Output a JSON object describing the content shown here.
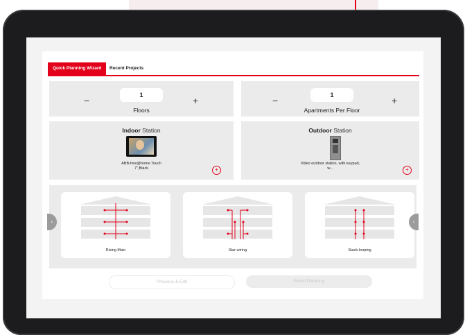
{
  "tabs": [
    {
      "label": "Quick Planning Wizard",
      "active": true
    },
    {
      "label": "Recent Projects",
      "active": false
    }
  ],
  "floors": {
    "value": "1",
    "label": "Floors",
    "minus": "−",
    "plus": "+"
  },
  "apartments": {
    "value": "1",
    "label": "Apartments Per Floor",
    "minus": "−",
    "plus": "+"
  },
  "indoor": {
    "title_bold": "Indoor",
    "title_rest": " Station",
    "desc_line1": "ABB-free@home Touch",
    "desc_line2": "7\",Black",
    "add": "+"
  },
  "outdoor": {
    "title_bold": "Outdoor",
    "title_rest": " Station",
    "desc_line1": "Video outdoor station, with keypad,",
    "desc_line2": "w...",
    "add": "+"
  },
  "topologies": [
    {
      "label": "Rising Main"
    },
    {
      "label": "Star-wiring"
    },
    {
      "label": "Stack-looping"
    }
  ],
  "carousel": {
    "prev": "‹",
    "next": "›"
  },
  "buttons": {
    "prev": "Previous & Edit",
    "finish": "Finish Planning"
  },
  "colors": {
    "accent": "#e2001a",
    "panel_gray": "#ebebeb",
    "frame": "#1c1c1e"
  }
}
